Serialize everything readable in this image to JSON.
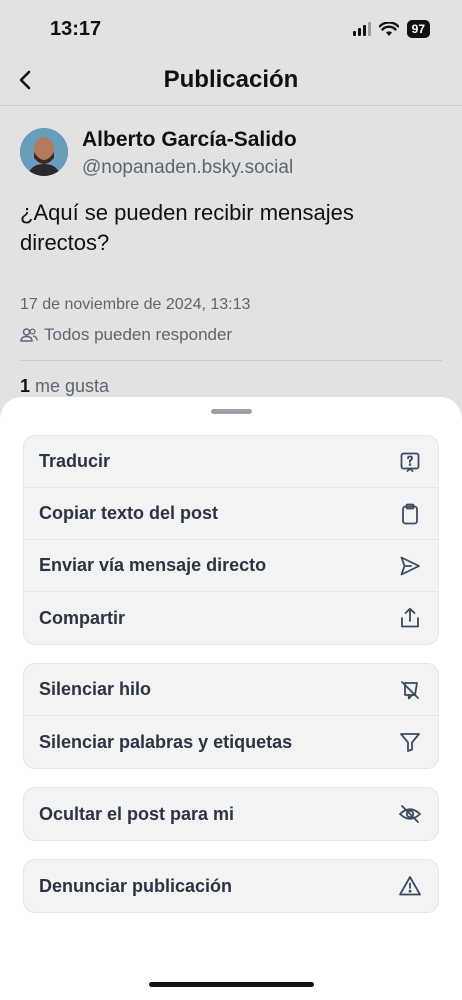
{
  "status": {
    "time": "13:17",
    "battery": "97"
  },
  "nav": {
    "title": "Publicación"
  },
  "post": {
    "author_name": "Alberto García-Salido",
    "author_handle": "@nopanaden.bsky.social",
    "text": "¿Aquí se pueden recibir mensajes directos?",
    "date": "17 de noviembre de 2024, 13:13",
    "reply_setting": "Todos pueden responder",
    "likes_count": "1",
    "likes_label": "me gusta"
  },
  "menu": {
    "group1": [
      {
        "label": "Traducir",
        "icon": "translate-icon"
      },
      {
        "label": "Copiar texto del post",
        "icon": "clipboard-icon"
      },
      {
        "label": "Enviar vía mensaje directo",
        "icon": "send-icon"
      },
      {
        "label": "Compartir",
        "icon": "share-icon"
      }
    ],
    "group2": [
      {
        "label": "Silenciar hilo",
        "icon": "mute-thread-icon"
      },
      {
        "label": "Silenciar palabras y etiquetas",
        "icon": "filter-icon"
      }
    ],
    "group3": [
      {
        "label": "Ocultar el post para mi",
        "icon": "eye-slash-icon"
      }
    ],
    "group4": [
      {
        "label": "Denunciar publicación",
        "icon": "warning-icon"
      }
    ]
  }
}
